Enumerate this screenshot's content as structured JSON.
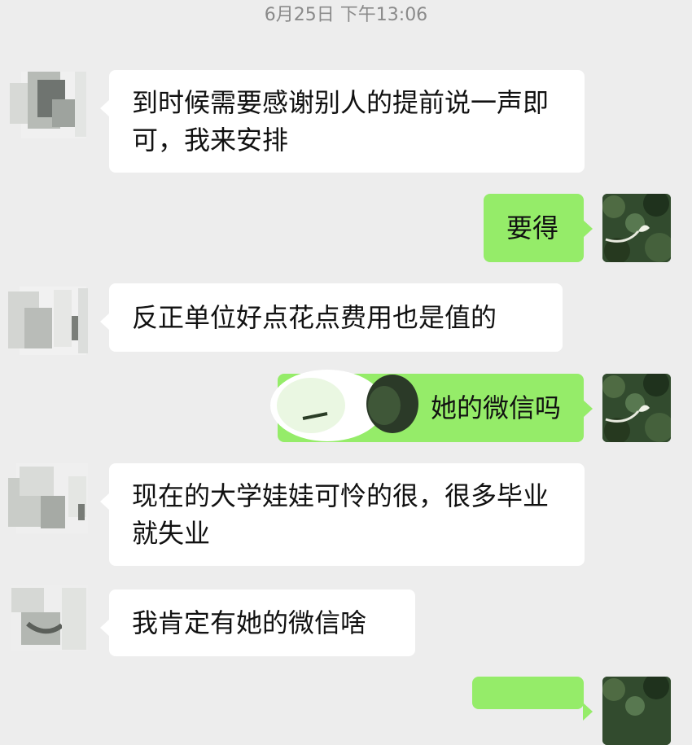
{
  "chat": {
    "timestamp": "6月25日 下午13:06",
    "messages": [
      {
        "side": "left",
        "text": "到时候需要感谢别人的提前说一声即可，我来安排"
      },
      {
        "side": "right",
        "text": "要得"
      },
      {
        "side": "left",
        "text": "反正单位好点花点费用也是值的"
      },
      {
        "side": "right",
        "text": "她的微信吗"
      },
      {
        "side": "left",
        "text": "现在的大学娃娃可怜的很，很多毕业就失业"
      },
      {
        "side": "left",
        "text": "我肯定有她的微信啥"
      }
    ]
  },
  "colors": {
    "background": "#ededed",
    "incoming_bubble": "#ffffff",
    "outgoing_bubble": "#95ec69",
    "timestamp_text": "#8a8a8a"
  },
  "icons": {
    "contact_avatar": "blurred-contact-avatar-icon",
    "self_avatar": "plant-sprout-avatar-icon"
  }
}
